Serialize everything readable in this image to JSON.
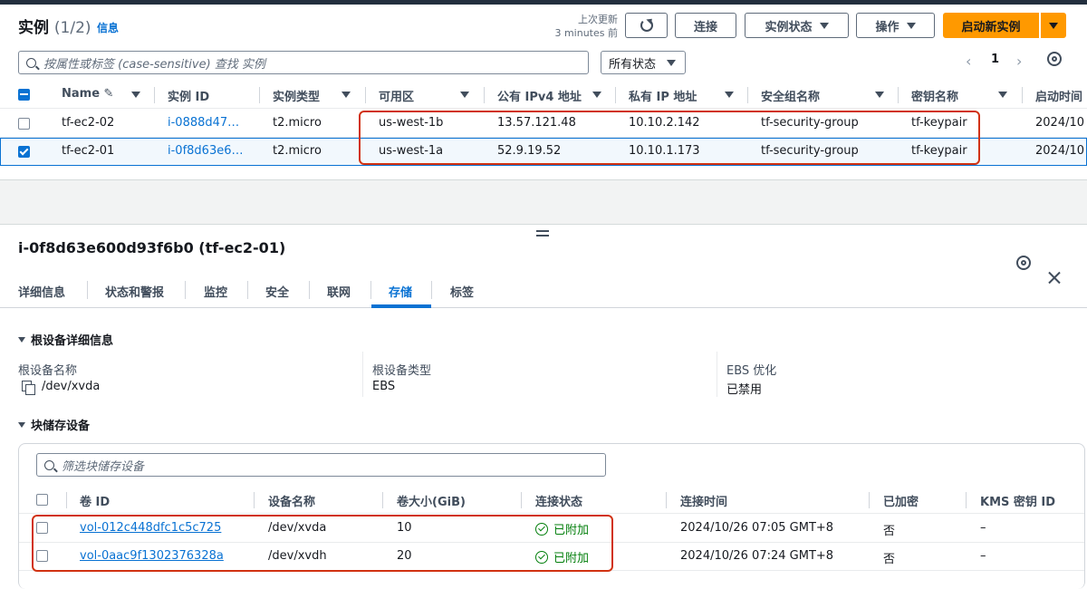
{
  "header": {
    "title": "实例",
    "count": "(1/2)",
    "info": "信息",
    "last_updated_label": "上次更新",
    "last_updated_value": "3 minutes 前",
    "connect": "连接",
    "instance_state": "实例状态",
    "actions": "操作",
    "launch": "启动新实例"
  },
  "search": {
    "placeholder": "按属性或标签 (case-sensitive) 查找 实例",
    "state_filter": "所有状态",
    "page": "1"
  },
  "instances_table": {
    "columns": [
      "Name",
      "实例 ID",
      "实例类型",
      "可用区",
      "公有 IPv4 地址",
      "私有 IP 地址",
      "安全组名称",
      "密钥名称",
      "启动时间"
    ],
    "rows": [
      {
        "name": "tf-ec2-02",
        "id": "i-0888d47…",
        "type": "t2.micro",
        "az": "us-west-1b",
        "public_ip": "13.57.121.48",
        "private_ip": "10.10.2.142",
        "sg": "tf-security-group",
        "key": "tf-keypair",
        "launch": "2024/10",
        "selected": false
      },
      {
        "name": "tf-ec2-01",
        "id": "i-0f8d63e6…",
        "type": "t2.micro",
        "az": "us-west-1a",
        "public_ip": "52.9.19.52",
        "private_ip": "10.10.1.173",
        "sg": "tf-security-group",
        "key": "tf-keypair",
        "launch": "2024/10",
        "selected": true
      }
    ]
  },
  "detail": {
    "title": "i-0f8d63e600d93f6b0 (tf-ec2-01)",
    "tabs": [
      "详细信息",
      "状态和警报",
      "监控",
      "安全",
      "联网",
      "存储",
      "标签"
    ],
    "active_tab": "存储",
    "root_section": "根设备详细信息",
    "root_device_name_label": "根设备名称",
    "root_device_name": "/dev/xvda",
    "root_device_type_label": "根设备类型",
    "root_device_type": "EBS",
    "ebs_opt_label": "EBS 优化",
    "ebs_opt": "已禁用",
    "block_section": "块储存设备",
    "block_filter_placeholder": "筛选块储存设备"
  },
  "volumes_table": {
    "columns": [
      "卷 ID",
      "设备名称",
      "卷大小(GiB)",
      "连接状态",
      "连接时间",
      "已加密",
      "KMS 密钥 ID"
    ],
    "rows": [
      {
        "volume_id": "vol-012c448dfc1c5c725",
        "device": "/dev/xvda",
        "size": "10",
        "status": "已附加",
        "time": "2024/10/26 07:05 GMT+8",
        "encrypted": "否",
        "kms": "–"
      },
      {
        "volume_id": "vol-0aac9f1302376328a",
        "device": "/dev/xvdh",
        "size": "20",
        "status": "已附加",
        "time": "2024/10/26 07:24 GMT+8",
        "encrypted": "否",
        "kms": "–"
      }
    ]
  },
  "colors": {
    "accent": "#0972d3",
    "primary_button": "#ff9900",
    "highlight": "#d13212",
    "success": "#037f0c"
  }
}
